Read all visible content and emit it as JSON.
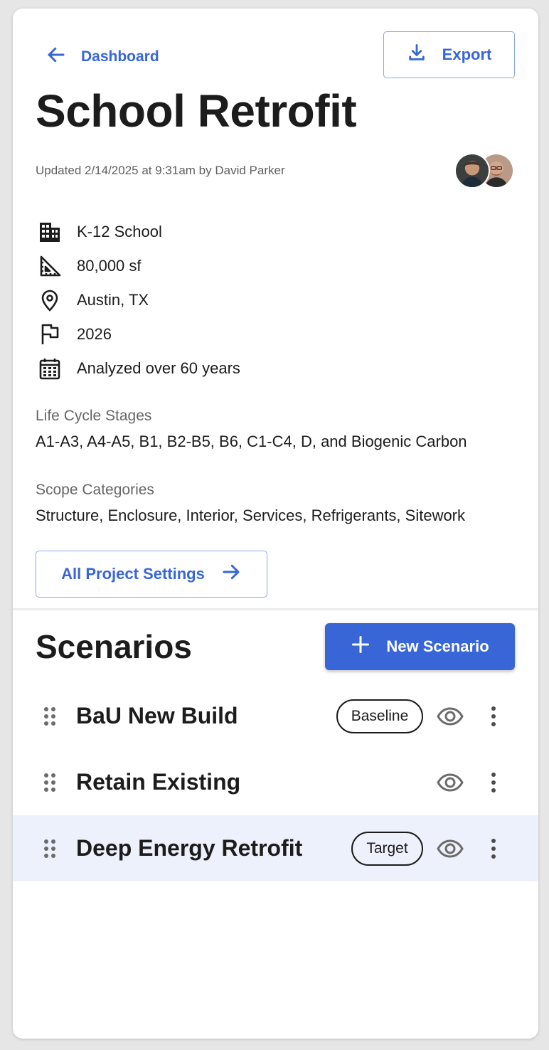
{
  "header": {
    "back_label": "Dashboard",
    "export_label": "Export"
  },
  "project": {
    "title": "School Retrofit",
    "updated": "Updated 2/14/2025 at 9:31am by David Parker",
    "meta": [
      {
        "icon": "building-icon",
        "text": "K-12 School"
      },
      {
        "icon": "ruler-triangle-icon",
        "text": "80,000 sf"
      },
      {
        "icon": "location-pin-icon",
        "text": "Austin, TX"
      },
      {
        "icon": "flag-icon",
        "text": "2026"
      },
      {
        "icon": "calendar-icon",
        "text": "Analyzed over 60 years"
      }
    ],
    "life_cycle": {
      "label": "Life Cycle Stages",
      "value": "A1-A3, A4-A5, B1, B2-B5, B6, C1-C4, D, and Biogenic Carbon"
    },
    "scope": {
      "label": "Scope Categories",
      "value": "Structure, Enclosure, Interior, Services, Refrigerants, Sitework"
    },
    "settings_label": "All Project Settings"
  },
  "scenarios": {
    "title": "Scenarios",
    "new_label": "New Scenario",
    "items": [
      {
        "name": "BaU New Build",
        "badge": "Baseline",
        "selected": false
      },
      {
        "name": "Retain Existing",
        "badge": "",
        "selected": false
      },
      {
        "name": "Deep Energy Retrofit",
        "badge": "Target",
        "selected": true
      }
    ]
  },
  "colors": {
    "accent": "#3866d6",
    "selected_row": "#ecf1fb",
    "text": "#1c1c1c",
    "muted": "#666666"
  }
}
